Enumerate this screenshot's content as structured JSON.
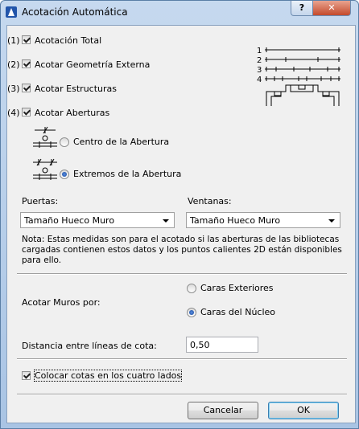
{
  "window": {
    "title": "Acotación Automática",
    "help_label": "?",
    "close_label": "✕"
  },
  "options": [
    {
      "num": "(1)",
      "label": "Acotación Total",
      "checked": true
    },
    {
      "num": "(2)",
      "label": "Acotar Geometría Externa",
      "checked": true
    },
    {
      "num": "(3)",
      "label": "Acotar Estructuras",
      "checked": true
    },
    {
      "num": "(4)",
      "label": "Acotar Aberturas",
      "checked": true
    }
  ],
  "preview": {
    "labels": [
      "1",
      "2",
      "3",
      "4"
    ]
  },
  "openings": {
    "center_label": "Centro de la Abertura",
    "ends_label": "Extremos de la Abertura",
    "selected": "ends"
  },
  "doors": {
    "label": "Puertas:",
    "value": "Tamaño Hueco Muro"
  },
  "windows": {
    "label": "Ventanas:",
    "value": "Tamaño Hueco Muro"
  },
  "note": "Nota: Estas medidas son para el acotado si las aberturas de las bibliotecas cargadas contienen estos datos y los puntos calientes 2D están disponibles para ello.",
  "walls": {
    "label": "Acotar Muros por:",
    "exterior_label": "Caras Exteriores",
    "core_label": "Caras del Núcleo",
    "selected": "core"
  },
  "distance": {
    "label": "Distancia entre líneas de cota:",
    "value": "0,50"
  },
  "four_sides": {
    "label": "Colocar cotas en los cuatro lados",
    "checked": true
  },
  "buttons": {
    "cancel": "Cancelar",
    "ok": "OK"
  }
}
